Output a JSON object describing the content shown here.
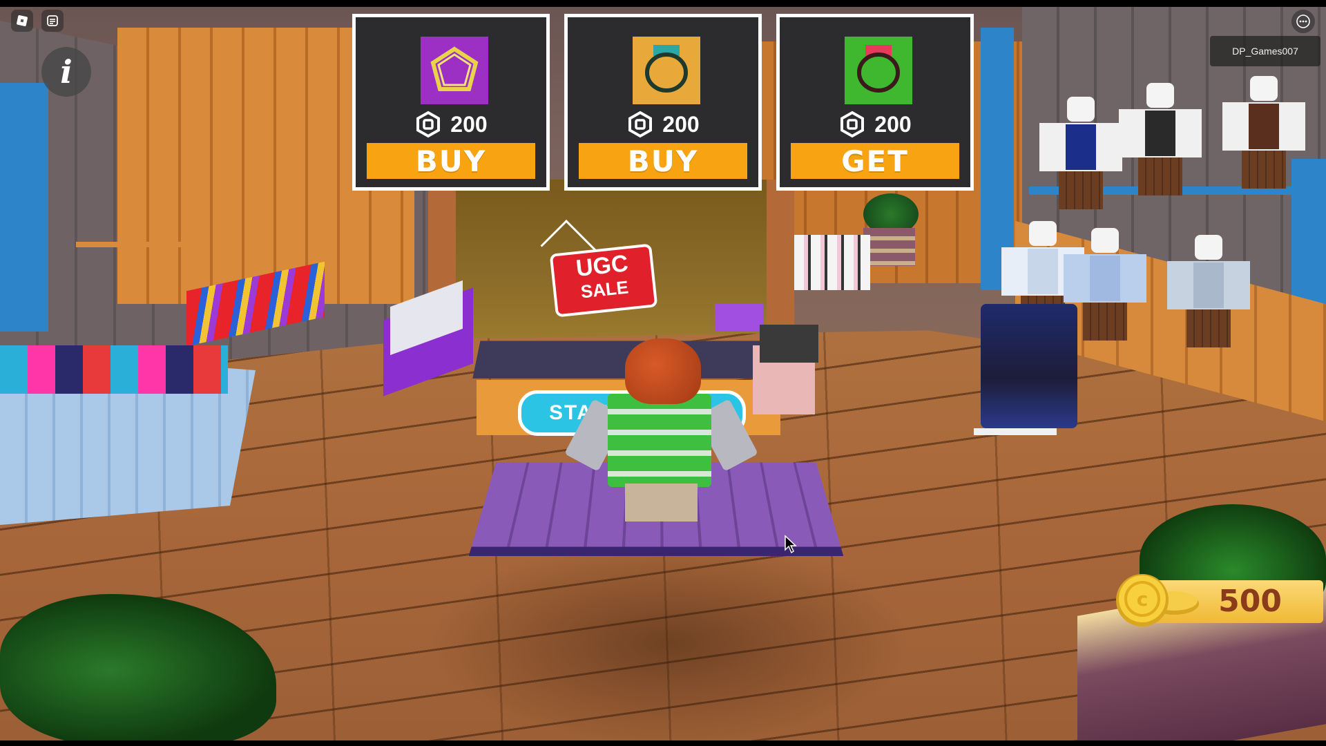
{
  "hud": {
    "roblox_menu_icon": "roblox-logo-icon",
    "chat_icon": "chat-icon",
    "info_icon": "info-icon",
    "info_glyph": "i",
    "username": "DP_Games007",
    "more_icon": "more-options-icon"
  },
  "shop": {
    "items": [
      {
        "icon": "purple-pentagon-item-icon",
        "thumb_color": "#9c2fc4",
        "price": "200",
        "currency_icon": "robux-icon",
        "action_label": "BUY"
      },
      {
        "icon": "gold-ring-item-icon",
        "thumb_color": "#e9a83a",
        "price": "200",
        "currency_icon": "robux-icon",
        "action_label": "BUY"
      },
      {
        "icon": "green-ring-item-icon",
        "thumb_color": "#3fb82f",
        "price": "200",
        "currency_icon": "robux-icon",
        "action_label": "GET"
      }
    ]
  },
  "scene": {
    "sign_line1": "UGC",
    "sign_line2": "SALE",
    "counter_text": "STAN"
  },
  "currency": {
    "icon": "gold-coin-icon",
    "value": "500"
  },
  "colors": {
    "button_orange": "#f8a412",
    "card_bg": "#2c2c2e",
    "card_border": "#ffffff",
    "coin_text": "#8a3b1a"
  }
}
